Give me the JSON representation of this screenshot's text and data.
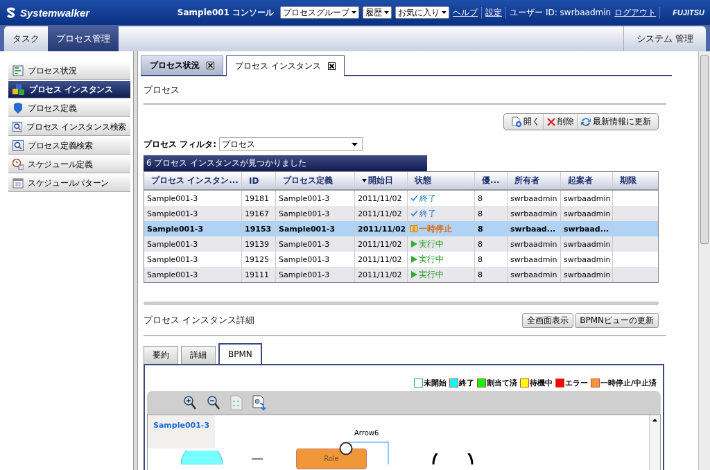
{
  "header": {
    "logo": "Systemwalker",
    "console": "Sample001 コンソール",
    "dropdowns": [
      "プロセスグループ",
      "履歴",
      "お気に入り"
    ],
    "links": [
      "ヘルプ",
      "設定"
    ],
    "user": "ユーザー ID: swrbaadmin",
    "logout": "ログアウト",
    "brand": "FUJITSU"
  },
  "main_tabs": [
    {
      "label": "タスク",
      "selected": false
    },
    {
      "label": "プロセス管理",
      "selected": true
    }
  ],
  "right_tab": "システム 管理",
  "sidebar": {
    "items": [
      {
        "label": "プロセス状況",
        "kind": "status",
        "selected": false
      },
      {
        "label": "プロセス インスタンス",
        "kind": "instance",
        "selected": true
      },
      {
        "label": "プロセス定義",
        "kind": "definition",
        "selected": false
      },
      {
        "label": "プロセス インスタンス検索",
        "kind": "search",
        "selected": false
      },
      {
        "label": "プロセス定義検索",
        "kind": "search",
        "selected": false
      },
      {
        "label": "スケジュール定義",
        "kind": "clock",
        "selected": false
      },
      {
        "label": "スケジュールパターン",
        "kind": "calendar",
        "selected": false
      }
    ]
  },
  "content_tabs": [
    {
      "label": "プロセス状況",
      "selected": false
    },
    {
      "label": "プロセス インスタンス",
      "selected": true
    }
  ],
  "process": {
    "title": "プロセス",
    "actions": [
      {
        "label": "開く",
        "kind": "open"
      },
      {
        "label": "削除",
        "kind": "delete"
      },
      {
        "label": "最新情報に更新",
        "kind": "refresh"
      }
    ],
    "filter_label": "プロセス フィルタ:",
    "filter_value": "プロセス",
    "result": "6 プロセス インスタンスが見つかりました"
  },
  "table": {
    "columns": [
      {
        "label": "プロセス インスタン...",
        "sorted": false
      },
      {
        "label": "ID",
        "sorted": false
      },
      {
        "label": "プロセス定義",
        "sorted": false
      },
      {
        "label": "開始日",
        "sorted": true
      },
      {
        "label": "状態",
        "sorted": false
      },
      {
        "label": "優...",
        "sorted": false
      },
      {
        "label": "所有者",
        "sorted": false
      },
      {
        "label": "起案者",
        "sorted": false
      },
      {
        "label": "期限",
        "sorted": false
      }
    ],
    "rows": [
      {
        "cells": [
          "Sample001-3",
          "19181",
          "Sample001-3",
          "2011/11/02",
          "終了",
          "8",
          "swrbaadmin",
          "swrbaadmin"
        ],
        "kind": "done",
        "selected": false
      },
      {
        "cells": [
          "Sample001-3",
          "19167",
          "Sample001-3",
          "2011/11/02",
          "終了",
          "8",
          "swrbaadmin",
          "swrbaadmin"
        ],
        "kind": "done",
        "selected": false
      },
      {
        "cells": [
          "Sample001-3",
          "19153",
          "Sample001-3",
          "2011/11/02",
          "一時停止",
          "8",
          "swrbaad...",
          "swrbaad..."
        ],
        "kind": "paused",
        "selected": true
      },
      {
        "cells": [
          "Sample001-3",
          "19139",
          "Sample001-3",
          "2011/11/02",
          "実行中",
          "8",
          "swrbaadmin",
          "swrbaadmin"
        ],
        "kind": "running",
        "selected": false
      },
      {
        "cells": [
          "Sample001-3",
          "19125",
          "Sample001-3",
          "2011/11/02",
          "実行中",
          "8",
          "swrbaadmin",
          "swrbaadmin"
        ],
        "kind": "running",
        "selected": false
      },
      {
        "cells": [
          "Sample001-3",
          "19111",
          "Sample001-3",
          "2011/11/02",
          "実行中",
          "8",
          "swrbaadmin",
          "swrbaadmin"
        ],
        "kind": "running",
        "selected": false
      }
    ]
  },
  "detail": {
    "title": "プロセス インスタンス詳細",
    "buttons": [
      "全画面表示",
      "BPMNビューの更新"
    ],
    "tabs": [
      {
        "label": "要約",
        "selected": false
      },
      {
        "label": "詳細",
        "selected": false
      },
      {
        "label": "BPMN",
        "selected": true
      }
    ],
    "legend": [
      {
        "label": "未開始",
        "color": "#ffffff"
      },
      {
        "label": "終了",
        "color": "#00ffff"
      },
      {
        "label": "割当て済",
        "color": "#00ff00"
      },
      {
        "label": "待機中",
        "color": "#ffff00"
      },
      {
        "label": "エラー",
        "color": "#ff0000"
      },
      {
        "label": "一時停止/中止済",
        "color": "#f09838"
      }
    ],
    "diagram": {
      "pool": "Sample001-3",
      "arrow": "Arrow6",
      "role": "Role"
    }
  }
}
